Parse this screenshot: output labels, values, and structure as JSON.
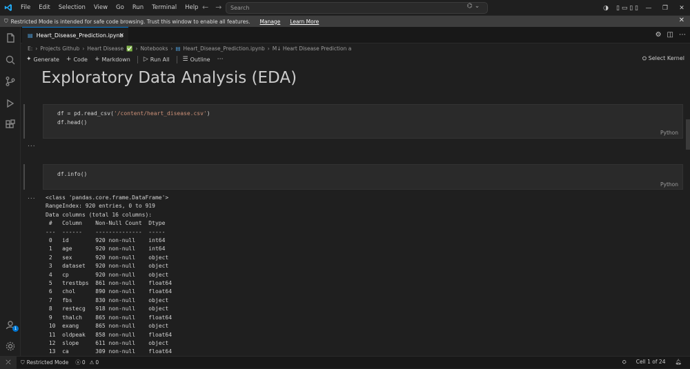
{
  "menu": [
    "File",
    "Edit",
    "Selection",
    "View",
    "Go",
    "Run",
    "Terminal",
    "Help"
  ],
  "search": {
    "placeholder": "Search"
  },
  "banner": {
    "message": "Restricted Mode is intended for safe code browsing. Trust this window to enable all features.",
    "manage": "Manage",
    "learn_more": "Learn More"
  },
  "tab": {
    "label": "Heart_Disease_Prediction.ipynb"
  },
  "breadcrumb": [
    "E:",
    "Projects Github",
    "Heart Disease",
    "Notebooks",
    "Heart_Disease_Prediction.ipynb",
    "M↓ Heart Disease Prediction a"
  ],
  "toolbar": {
    "generate": "Generate",
    "code": "Code",
    "markdown": "Markdown",
    "run_all": "Run All",
    "outline": "Outline",
    "select_kernel": "Select Kernel"
  },
  "notebook": {
    "heading": "Exploratory Data Analysis (EDA)",
    "cell1_line1_pre": "df = pd.read_csv(",
    "cell1_line1_str": "'/content/heart_disease.csv'",
    "cell1_line1_post": ")",
    "cell1_line2": "df.head()",
    "cell1_lang": "Python",
    "cell1_output": "...",
    "cell2_line1": "df.info()",
    "cell2_lang": "Python",
    "cell2_output_marker": "...",
    "cell2_output": "<class 'pandas.core.frame.DataFrame'>\nRangeIndex: 920 entries, 0 to 919\nData columns (total 16 columns):\n #   Column    Non-Null Count  Dtype  \n---  ------    --------------  -----  \n 0   id        920 non-null    int64  \n 1   age       920 non-null    int64  \n 2   sex       920 non-null    object \n 3   dataset   920 non-null    object \n 4   cp        920 non-null    object \n 5   trestbps  861 non-null    float64\n 6   chol      890 non-null    float64\n 7   fbs       830 non-null    object \n 8   restecg   918 non-null    object \n 9   thalch    865 non-null    float64\n 10  exang     865 non-null    object \n 11  oldpeak   858 non-null    float64\n 12  slope     611 non-null    object \n 13  ca        309 non-null    float64"
  },
  "accounts_badge": "1",
  "status": {
    "restricted": "Restricted Mode",
    "errors": "0",
    "warnings": "0",
    "cell": "Cell 1 of 24"
  }
}
